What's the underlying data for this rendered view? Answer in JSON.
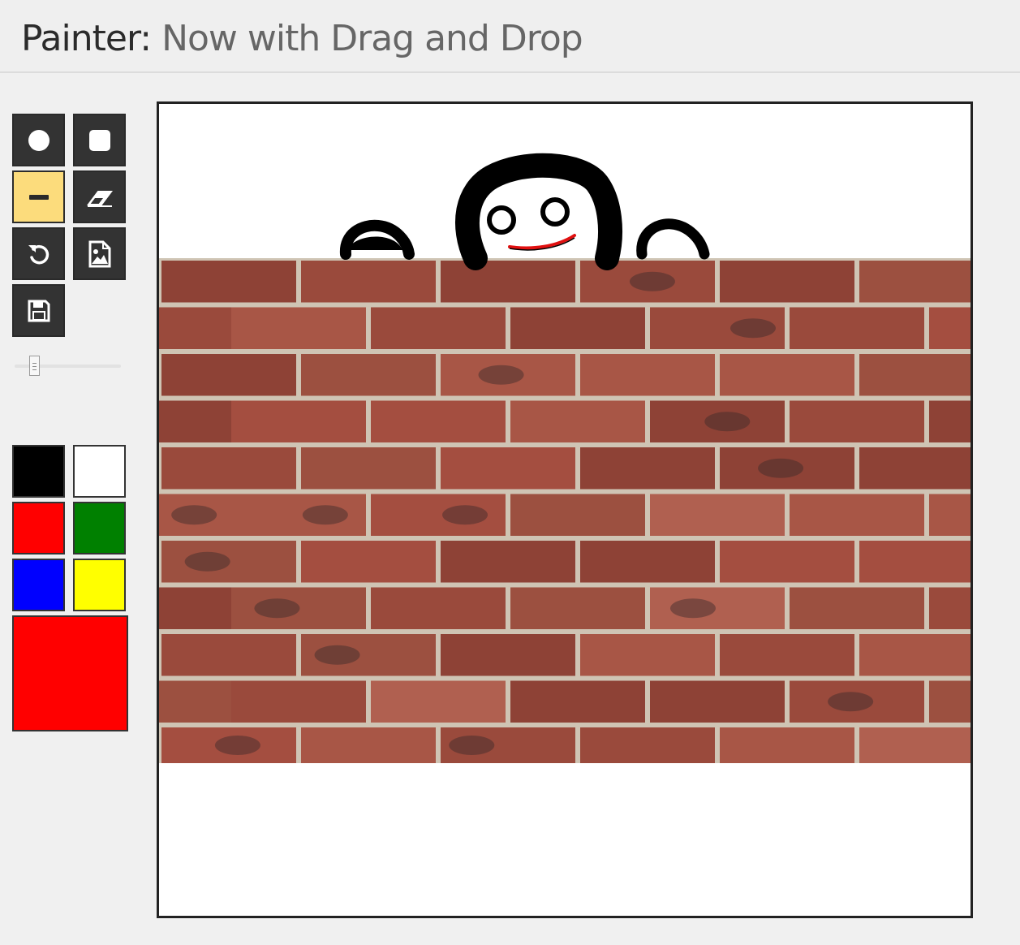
{
  "header": {
    "app_name": "Painter:",
    "subtitle": "Now with Drag and Drop"
  },
  "toolbar": {
    "tools": [
      {
        "name": "circle-brush",
        "icon": "circle-icon",
        "active": false
      },
      {
        "name": "square-brush",
        "icon": "square-icon",
        "active": false
      },
      {
        "name": "line-tool",
        "icon": "minus-icon",
        "active": true
      },
      {
        "name": "eraser",
        "icon": "eraser-icon",
        "active": false
      },
      {
        "name": "undo",
        "icon": "undo-icon",
        "active": false
      },
      {
        "name": "load-image",
        "icon": "image-file-icon",
        "active": false
      },
      {
        "name": "save",
        "icon": "floppy-disk-icon",
        "active": false
      }
    ],
    "brush_size_level": 0.15
  },
  "palette": {
    "colors": [
      "#000000",
      "#ffffff",
      "#ff0000",
      "#008000",
      "#0000ff",
      "#ffff00"
    ],
    "current_color": "#ff0000"
  },
  "canvas": {
    "background": "#ffffff",
    "wall_mortar": "#cfc4b4",
    "brick_colors": [
      "#9a4a3c",
      "#a85646",
      "#8e4236",
      "#b06050",
      "#9c5040",
      "#a44e40"
    ],
    "stroke_color": "#000000",
    "smile_color": "#e01010"
  }
}
